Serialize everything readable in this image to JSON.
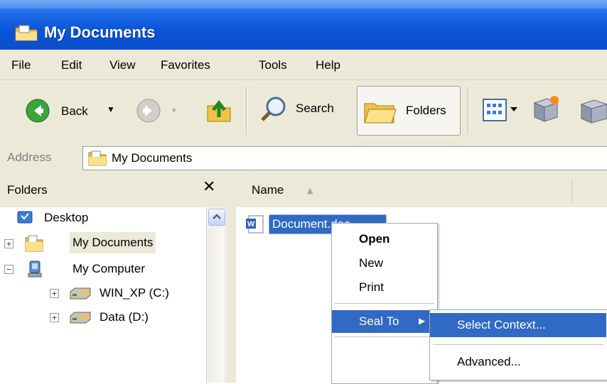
{
  "window": {
    "title": "My Documents"
  },
  "menubar": {
    "items": [
      "File",
      "Edit",
      "View",
      "Favorites",
      "Tools",
      "Help"
    ]
  },
  "toolbar": {
    "back_label": "Back",
    "search_label": "Search",
    "folders_label": "Folders"
  },
  "address": {
    "label": "Address",
    "value": "My Documents"
  },
  "folders_pane": {
    "title": "Folders",
    "close_glyph": "✕",
    "tree": [
      {
        "label": "Desktop",
        "expander": "",
        "icon": "desktop-icon"
      },
      {
        "label": "My Documents",
        "expander": "+",
        "icon": "folder-icon"
      },
      {
        "label": "My Computer",
        "expander": "−",
        "icon": "computer-icon"
      },
      {
        "label": "WIN_XP (C:)",
        "expander": "+",
        "icon": "drive-icon"
      },
      {
        "label": "Data (D:)",
        "expander": "+",
        "icon": "drive-icon"
      }
    ]
  },
  "file_list": {
    "column_name": "Name",
    "sort_glyph": "▲",
    "items": [
      {
        "label": "Document.doc",
        "icon": "word-document-icon",
        "selected": true
      }
    ]
  },
  "context_menu": {
    "items": [
      "Open",
      "New",
      "Print",
      "Seal To"
    ],
    "submenu_arrow": "▶"
  },
  "submenu": {
    "items": [
      "Select Context...",
      "Advanced..."
    ]
  },
  "colors": {
    "title_bar": "#0a55d8",
    "chrome": "#ece9d8",
    "selection": "#316ac5"
  }
}
